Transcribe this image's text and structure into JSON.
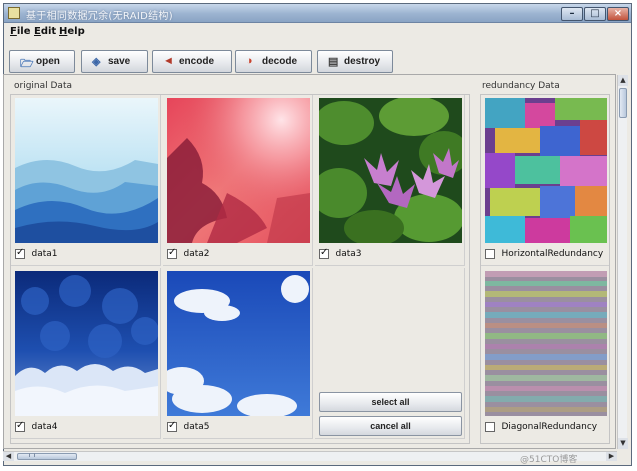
{
  "window": {
    "title": "基于相同数据冗余(无RAID结构)"
  },
  "menu": {
    "file": "File",
    "edit": "Edit",
    "help": "Help"
  },
  "toolbar": {
    "open": "open",
    "save": "save",
    "encode": "encode",
    "decode": "decode",
    "destroy": "destroy"
  },
  "original_panel": {
    "title": "original Data",
    "items": [
      {
        "label": "data1",
        "checked": true,
        "image": "blue-mountains"
      },
      {
        "label": "data2",
        "checked": true,
        "image": "red-sky-rays"
      },
      {
        "label": "data3",
        "checked": true,
        "image": "water-lilies"
      },
      {
        "label": "data4",
        "checked": true,
        "image": "snowy-forest"
      },
      {
        "label": "data5",
        "checked": true,
        "image": "blue-sky-clouds"
      }
    ],
    "select_all": "select all",
    "cancel_all": "cancel all"
  },
  "redundancy_panel": {
    "title": "redundancy Data",
    "items": [
      {
        "label": "HorizontalRedundancy",
        "checked": false,
        "image": "noise-colorful"
      },
      {
        "label": "DiagonalRedundancy",
        "checked": false,
        "image": "noise-striped"
      }
    ]
  },
  "watermark": "@51CTO博客"
}
